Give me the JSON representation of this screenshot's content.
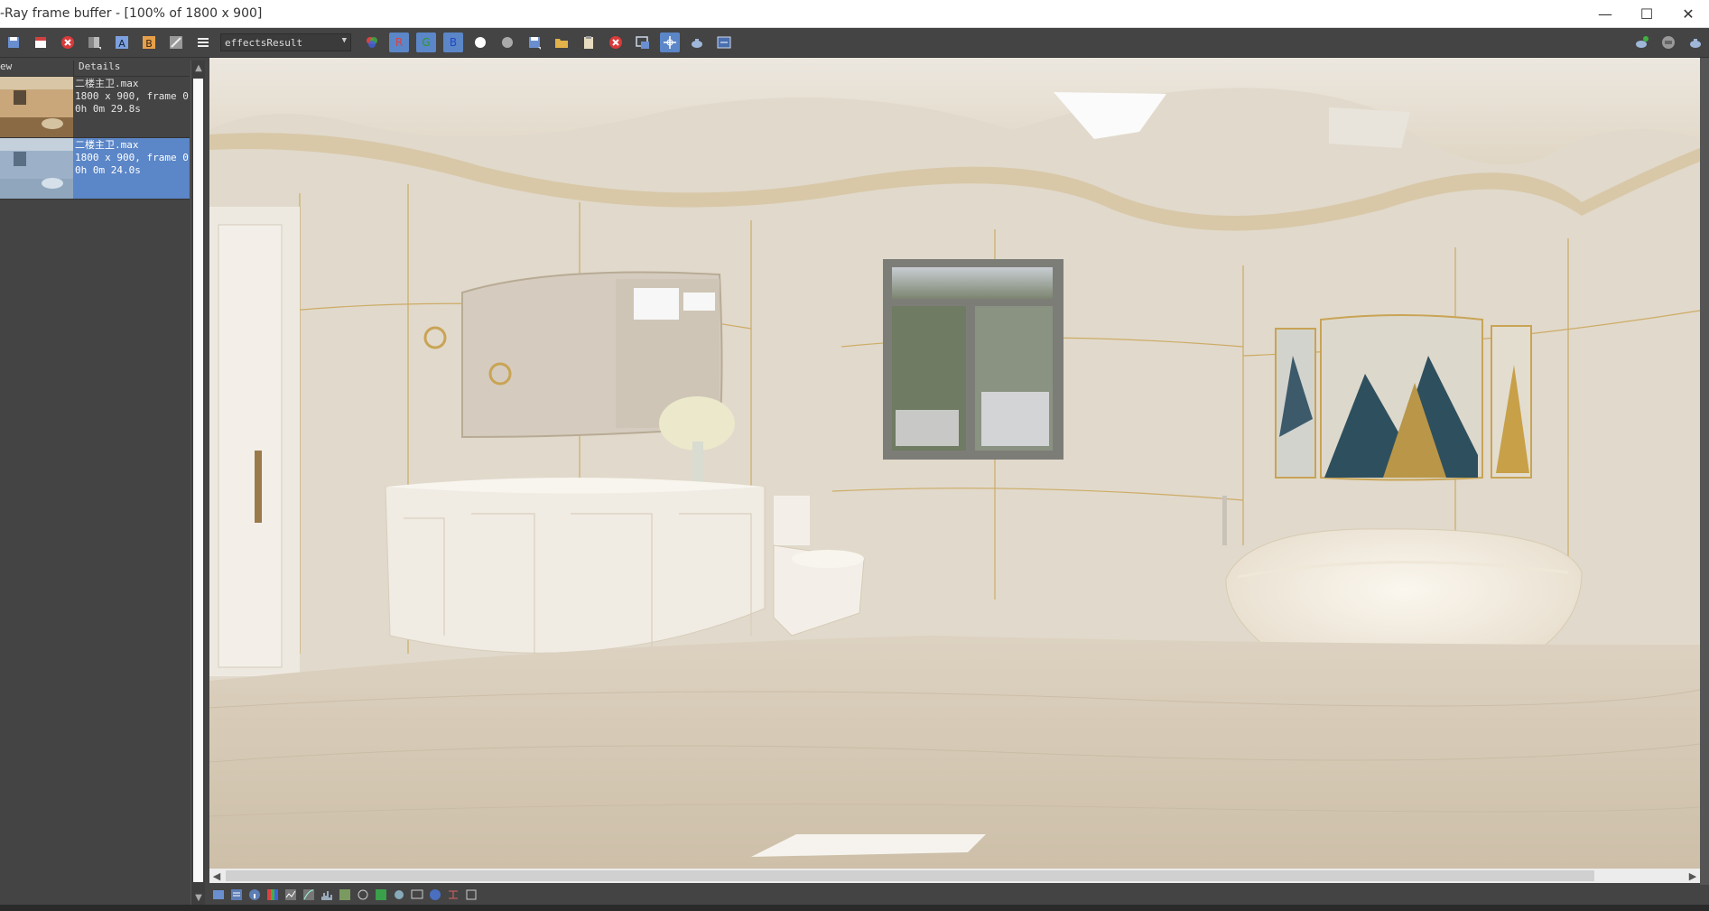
{
  "window": {
    "title": "-Ray frame buffer - [100% of 1800 x 900]",
    "minimize_glyph": "—",
    "maximize_glyph": "☐",
    "close_glyph": "✕"
  },
  "toolbar": {
    "channel_select_value": "effectsResult",
    "channel_r": "R",
    "channel_g": "G",
    "channel_b": "B"
  },
  "history": {
    "col_preview": "ew",
    "col_details": "Details",
    "items": [
      {
        "name": "二楼主卫.max",
        "res": "1800 x 900, frame 0",
        "time": "0h 0m 29.8s",
        "selected": false
      },
      {
        "name": "二楼主卫.max",
        "res": "1800 x 900, frame 0",
        "time": "0h 0m 24.0s",
        "selected": true
      }
    ]
  },
  "colors": {
    "accent": "#5b86c7",
    "panel": "#444444",
    "wall": "#e3dccf",
    "gold_line": "#c9a455"
  }
}
